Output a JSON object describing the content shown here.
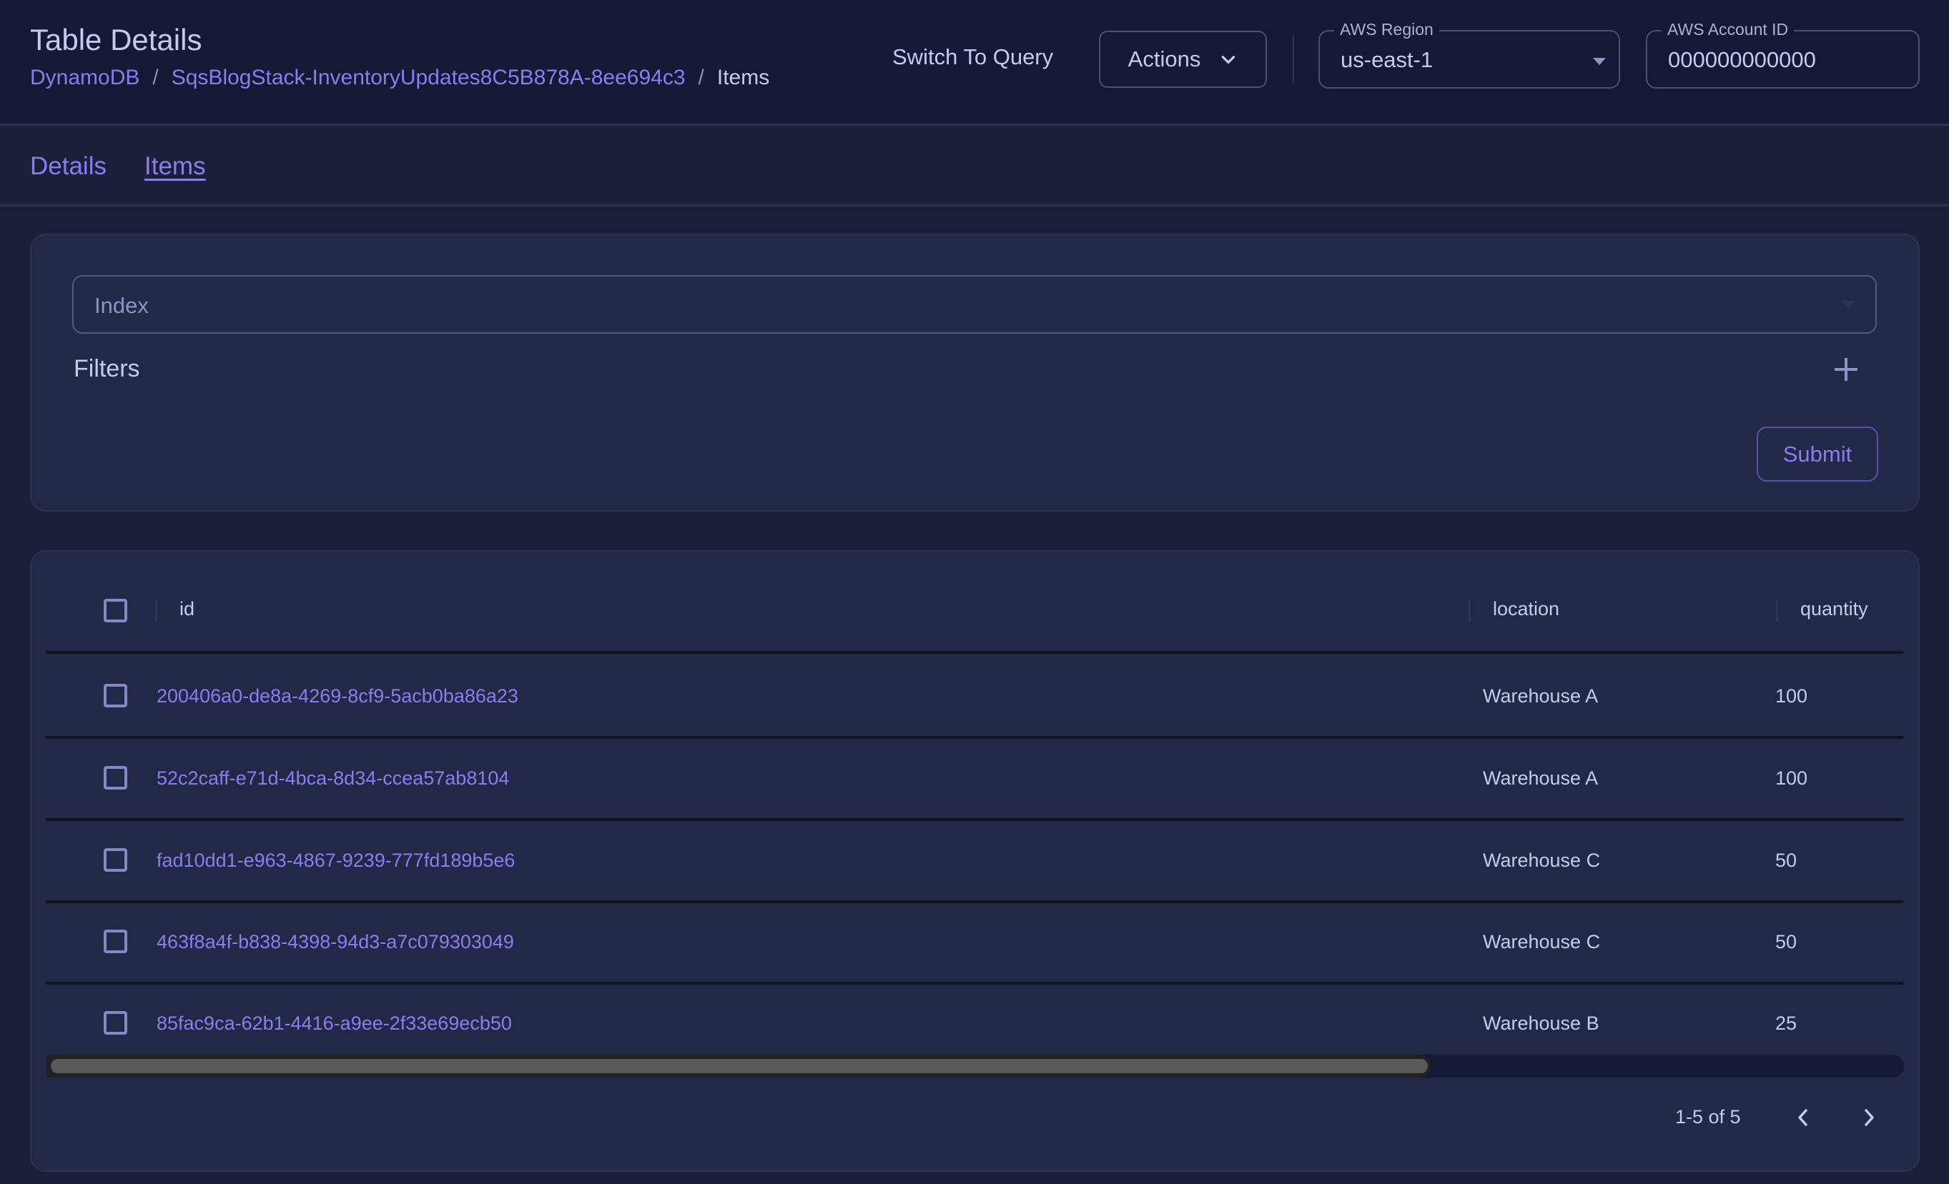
{
  "header": {
    "title": "Table Details",
    "breadcrumb": [
      {
        "label": "DynamoDB"
      },
      {
        "label": "SqsBlogStack-InventoryUpdates8C5B878A-8ee694c3"
      },
      {
        "label": "Items"
      }
    ],
    "breadcrumb_separator": "/",
    "switch_to_query_label": "Switch To Query",
    "actions_label": "Actions",
    "region": {
      "label": "AWS Region",
      "value": "us-east-1"
    },
    "account": {
      "label": "AWS Account ID",
      "value": "000000000000"
    }
  },
  "tabs": [
    {
      "label": "Details",
      "active": false
    },
    {
      "label": "Items",
      "active": true
    }
  ],
  "filter_panel": {
    "index_placeholder": "Index",
    "filters_label": "Filters",
    "submit_label": "Submit"
  },
  "table": {
    "columns": [
      "id",
      "location",
      "quantity"
    ],
    "rows": [
      {
        "id": "200406a0-de8a-4269-8cf9-5acb0ba86a23",
        "location": "Warehouse A",
        "quantity": "100"
      },
      {
        "id": "52c2caff-e71d-4bca-8d34-ccea57ab8104",
        "location": "Warehouse A",
        "quantity": "100"
      },
      {
        "id": "fad10dd1-e963-4867-9239-777fd189b5e6",
        "location": "Warehouse C",
        "quantity": "50"
      },
      {
        "id": "463f8a4f-b838-4398-94d3-a7c079303049",
        "location": "Warehouse C",
        "quantity": "50"
      },
      {
        "id": "85fac9ca-62b1-4416-a9ee-2f33e69ecb50",
        "location": "Warehouse B",
        "quantity": "25"
      }
    ],
    "horizontal_scroll_visible_fraction": 0.745,
    "pagination": "1-5 of 5"
  },
  "colors": {
    "accent": "#8b7cf0",
    "background": "#1a2038",
    "header_background": "#141a35",
    "card_background": "#222946",
    "text": "#c3cbee"
  }
}
